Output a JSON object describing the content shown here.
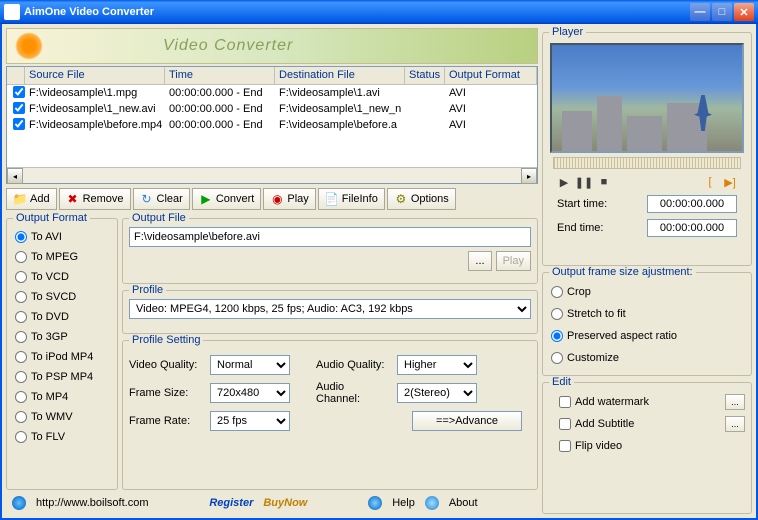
{
  "title": "AimOne Video Converter",
  "banner_text": "Video Converter",
  "table": {
    "headers": {
      "chk": "",
      "source": "Source File",
      "time": "Time",
      "dest": "Destination File",
      "status": "Status",
      "format": "Output Format"
    },
    "rows": [
      {
        "source": "F:\\videosample\\1.mpg",
        "time": "00:00:00.000 - End",
        "dest": "F:\\videosample\\1.avi",
        "status": "",
        "format": "AVI"
      },
      {
        "source": "F:\\videosample\\1_new.avi",
        "time": "00:00:00.000 - End",
        "dest": "F:\\videosample\\1_new_n",
        "status": "",
        "format": "AVI"
      },
      {
        "source": "F:\\videosample\\before.mp4",
        "time": "00:00:00.000 - End",
        "dest": "F:\\videosample\\before.a",
        "status": "",
        "format": "AVI"
      }
    ]
  },
  "toolbar": {
    "add": "Add",
    "remove": "Remove",
    "clear": "Clear",
    "convert": "Convert",
    "play": "Play",
    "fileinfo": "FileInfo",
    "options": "Options"
  },
  "output_format": {
    "title": "Output Format",
    "items": [
      "To AVI",
      "To MPEG",
      "To VCD",
      "To SVCD",
      "To DVD",
      "To 3GP",
      "To iPod MP4",
      "To PSP MP4",
      "To MP4",
      "To WMV",
      "To FLV"
    ],
    "selected": 0
  },
  "output_file": {
    "title": "Output File",
    "path": "F:\\videosample\\before.avi",
    "browse": "...",
    "play": "Play"
  },
  "profile": {
    "title": "Profile",
    "value": "Video: MPEG4, 1200 kbps, 25 fps;  Audio: AC3, 192 kbps"
  },
  "profile_setting": {
    "title": "Profile Setting",
    "video_quality_label": "Video Quality:",
    "video_quality": "Normal",
    "frame_size_label": "Frame Size:",
    "frame_size": "720x480",
    "frame_rate_label": "Frame Rate:",
    "frame_rate": "25 fps",
    "audio_quality_label": "Audio Quality:",
    "audio_quality": "Higher",
    "audio_channel_label": "Audio Channel:",
    "audio_channel": "2(Stereo)",
    "advance": "==>Advance"
  },
  "footer": {
    "url": "http://www.boilsoft.com",
    "register": "Register",
    "buynow": "BuyNow",
    "help": "Help",
    "about": "About"
  },
  "player": {
    "title": "Player",
    "start_label": "Start time:",
    "start": "00:00:00.000",
    "end_label": "End  time:",
    "end": "00:00:00.000"
  },
  "adjust": {
    "title": "Output frame size ajustment:",
    "items": [
      "Crop",
      "Stretch to fit",
      "Preserved aspect ratio",
      "Customize"
    ],
    "selected": 2
  },
  "edit": {
    "title": "Edit",
    "watermark": "Add watermark",
    "subtitle": "Add Subtitle",
    "flip": "Flip video"
  }
}
